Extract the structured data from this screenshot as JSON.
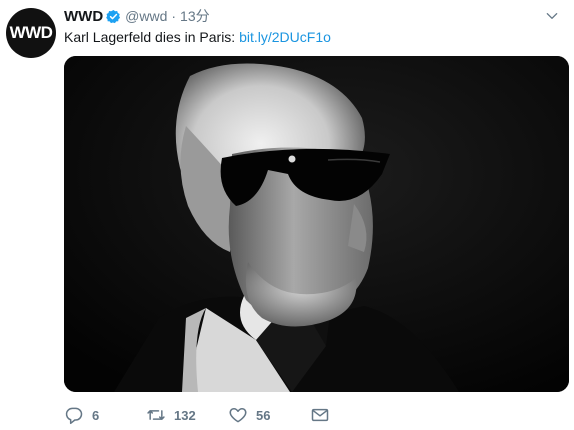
{
  "account": {
    "avatar_text": "WWD",
    "display_name": "WWD",
    "handle": "@wwd",
    "separator": "·",
    "time": "13分",
    "verified": true
  },
  "tweet": {
    "text": "Karl Lagerfeld dies in Paris: ",
    "link": "bit.ly/2DUcF1o"
  },
  "actions": {
    "replies": "6",
    "retweets": "132",
    "likes": "56"
  },
  "icons": {
    "verified": "verified-badge-icon",
    "menu": "chevron-down-icon",
    "reply": "reply-icon",
    "retweet": "retweet-icon",
    "like": "heart-icon",
    "dm": "envelope-icon"
  },
  "colors": {
    "link": "#1b95e0",
    "verified": "#1da1f2",
    "meta_text": "#657786",
    "text": "#14171a",
    "avatar_bg": "#111111"
  }
}
